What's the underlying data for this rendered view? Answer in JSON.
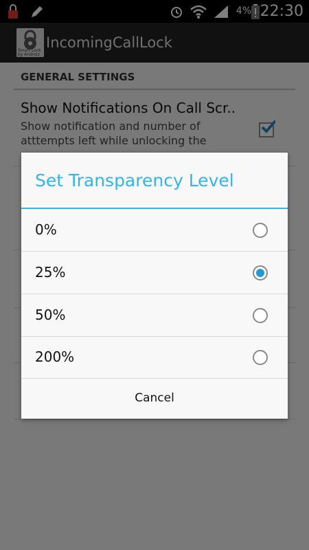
{
  "status_bar": {
    "battery_percent": "4%",
    "time": "22:30",
    "icons": [
      "lock-notification-icon",
      "pencil-icon",
      "alarm-icon",
      "wifi-icon",
      "signal-icon",
      "battery-icon"
    ]
  },
  "app": {
    "title": "IncomingCallLock",
    "icon_text_line1": "Smart Lock",
    "icon_text_line2": "by Androiz"
  },
  "settings": {
    "section_header": "GENERAL SETTINGS",
    "pref_title": "Show Notifications On Call Scr..",
    "pref_summary": "Show notification and number of atttempts left while unlocking the",
    "pref_checked": true
  },
  "dialog": {
    "title": "Set Transparency Level",
    "options": [
      {
        "label": "0%",
        "checked": false
      },
      {
        "label": "25%",
        "checked": true
      },
      {
        "label": "50%",
        "checked": false
      },
      {
        "label": "200%",
        "checked": false
      }
    ],
    "cancel_label": "Cancel"
  },
  "colors": {
    "accent": "#33b5e5",
    "radio_selected": "#1e9ad6",
    "statusbar": "#000000",
    "actionbar": "#222222"
  }
}
